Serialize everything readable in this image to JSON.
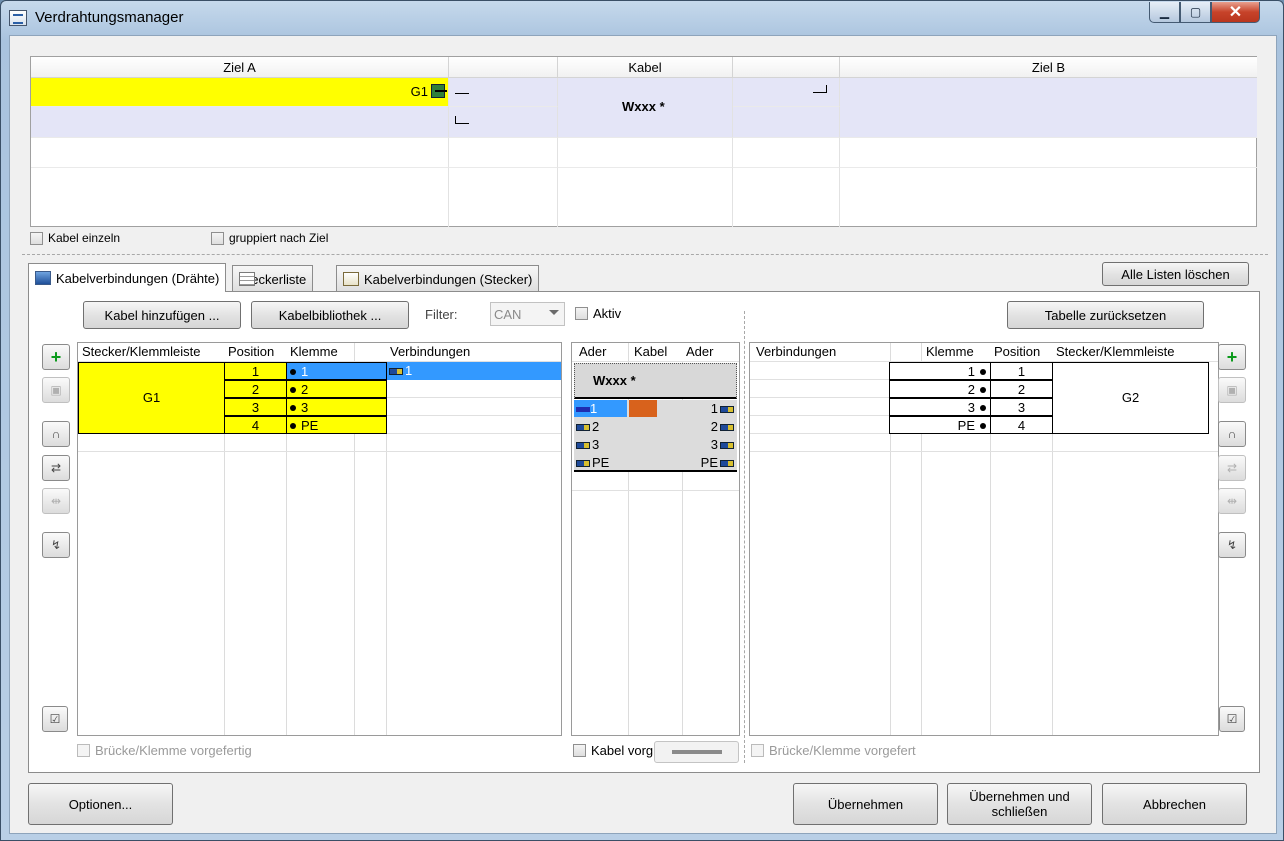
{
  "window": {
    "title": "Verdrahtungsmanager",
    "min": "▁",
    "max": "▢",
    "close": "✕"
  },
  "top_grid": {
    "headers": {
      "ziel_a": "Ziel A",
      "kabel": "Kabel",
      "ziel_b": "Ziel B"
    },
    "row": {
      "ziel_a": "G1",
      "kabel": "Wxxx *"
    }
  },
  "checkboxes": {
    "kabel_einzeln": "Kabel einzeln",
    "gruppiert": "gruppiert nach Ziel"
  },
  "tabs": [
    {
      "label": "Kabelverbindungen (Drähte)",
      "icon": "wire-connection-icon"
    },
    {
      "label": "Steckerliste",
      "icon": "table-icon"
    },
    {
      "label": "Kabelverbindungen (Stecker)",
      "icon": "connector-doc-icon"
    }
  ],
  "alle_listen_loeschen": "Alle Listen löschen",
  "toolbar": {
    "kabel_hinzufuegen": "Kabel hinzufügen ...",
    "kabelbibliothek": "Kabelbibliothek ...",
    "filter_label": "Filter:",
    "filter_value": "CAN",
    "aktiv": "Aktiv",
    "tabelle_zuruecksetzen": "Tabelle zurücksetzen"
  },
  "left_grid": {
    "headers": [
      "Stecker/Klemmleiste",
      "Position",
      "Klemme",
      "Verbindungen"
    ],
    "stecker": "G1",
    "rows": [
      {
        "position": "1",
        "klemme": "1",
        "verbindung": "1"
      },
      {
        "position": "2",
        "klemme": "2",
        "verbindung": ""
      },
      {
        "position": "3",
        "klemme": "3",
        "verbindung": ""
      },
      {
        "position": "4",
        "klemme": "PE",
        "verbindung": ""
      }
    ],
    "bruecke": "Brücke/Klemme vorgefertig"
  },
  "mid_grid": {
    "headers": [
      "Ader",
      "Kabel",
      "Ader"
    ],
    "cable": "Wxxx *",
    "rows": [
      {
        "ader_a": "1",
        "ader_b": "1"
      },
      {
        "ader_a": "2",
        "ader_b": "2"
      },
      {
        "ader_a": "3",
        "ader_b": "3"
      },
      {
        "ader_a": "PE",
        "ader_b": "PE"
      }
    ],
    "wire_colors": {
      "row1_a": "#1f2db0",
      "row1_kabel": "#d8621c"
    },
    "kabel_vorg": "Kabel vorg"
  },
  "right_grid": {
    "headers": [
      "Verbindungen",
      "Klemme",
      "Position",
      "Stecker/Klemmleiste"
    ],
    "stecker": "G2",
    "rows": [
      {
        "klemme": "1",
        "position": "1"
      },
      {
        "klemme": "2",
        "position": "2"
      },
      {
        "klemme": "3",
        "position": "3"
      },
      {
        "klemme": "PE",
        "position": "4"
      }
    ],
    "bruecke": "Brücke/Klemme vorgefert"
  },
  "footer": {
    "optionen": "Optionen...",
    "uebernehmen": "Übernehmen",
    "uebernehmen_schliessen_1": "Übernehmen und",
    "uebernehmen_schliessen_2": "schließen",
    "abbrechen": "Abbrechen"
  },
  "colors": {
    "highlight": "#ffff00",
    "selection": "#3399ff",
    "band": "#e4e5f7"
  }
}
